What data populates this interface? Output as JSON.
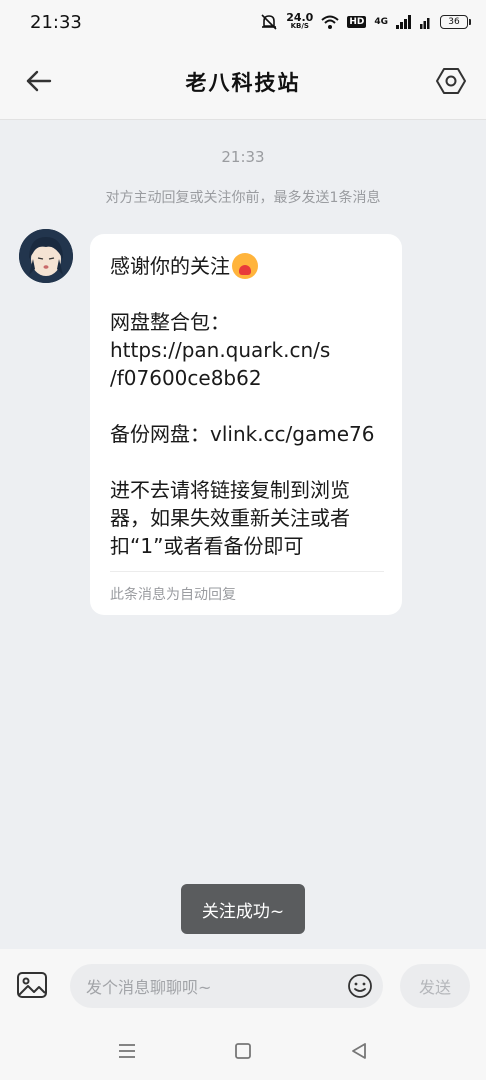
{
  "status_bar": {
    "time": "21:33",
    "net_speed": "24.0",
    "net_unit": "KB/S",
    "hd": "HD",
    "signal_label": "4G",
    "battery": "36"
  },
  "header": {
    "title": "老八科技站",
    "back_icon": "arrow-left-icon",
    "settings_icon": "hexagon-gear-icon"
  },
  "chat": {
    "timestamp": "21:33",
    "notice": "对方主动回复或关注你前，最多发送1条消息",
    "message": {
      "lines": [
        "感谢你的关注",
        "",
        "网盘整合包：",
        "https://pan.quark.cn/s",
        "/f07600ce8b62",
        "",
        "备份网盘：vlink.cc/game76",
        "",
        "进不去请将链接复制到浏览",
        "器，如果失效重新关注或者",
        "扣“1”或者看备份即可"
      ],
      "footer": "此条消息为自动回复"
    }
  },
  "toast": "关注成功~",
  "input_bar": {
    "placeholder": "发个消息聊聊呗~",
    "send_label": "发送"
  },
  "nav_bar": {
    "menu_icon": "menu-icon",
    "home_icon": "square-home-icon",
    "back_icon": "triangle-back-icon"
  }
}
